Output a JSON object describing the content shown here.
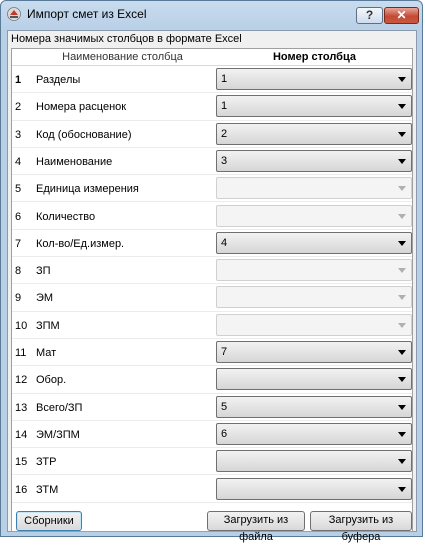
{
  "window": {
    "title": "Импорт смет из Excel",
    "help_label": "?",
    "close_label": "✕"
  },
  "caption": "Номера значимых столбцов в формате Excel",
  "columns": {
    "name": "Наименование столбца",
    "number": "Номер столбца"
  },
  "rows": [
    {
      "n": "1",
      "name": "Разделы",
      "value": "1",
      "enabled": true
    },
    {
      "n": "2",
      "name": "Номера расценок",
      "value": "1",
      "enabled": true
    },
    {
      "n": "3",
      "name": "Код (обоснование)",
      "value": "2",
      "enabled": true
    },
    {
      "n": "4",
      "name": "Наименование",
      "value": "3",
      "enabled": true
    },
    {
      "n": "5",
      "name": "Единица измерения",
      "value": "",
      "enabled": false
    },
    {
      "n": "6",
      "name": "Количество",
      "value": "",
      "enabled": false
    },
    {
      "n": "7",
      "name": "Кол-во/Ед.измер.",
      "value": "4",
      "enabled": true
    },
    {
      "n": "8",
      "name": "ЗП",
      "value": "",
      "enabled": false
    },
    {
      "n": "9",
      "name": "ЭМ",
      "value": "",
      "enabled": false
    },
    {
      "n": "10",
      "name": "ЗПМ",
      "value": "",
      "enabled": false
    },
    {
      "n": "11",
      "name": "Мат",
      "value": "7",
      "enabled": true
    },
    {
      "n": "12",
      "name": "Обор.",
      "value": "",
      "enabled": true
    },
    {
      "n": "13",
      "name": "Всего/ЗП",
      "value": "5",
      "enabled": true
    },
    {
      "n": "14",
      "name": "ЭМ/ЗПМ",
      "value": "6",
      "enabled": true
    },
    {
      "n": "15",
      "name": "ЗТР",
      "value": "",
      "enabled": true
    },
    {
      "n": "16",
      "name": "ЗТМ",
      "value": "",
      "enabled": true
    }
  ],
  "buttons": {
    "collections": "Сборники",
    "load_file": "Загрузить из файла",
    "load_buffer": "Загрузить из буфера"
  }
}
